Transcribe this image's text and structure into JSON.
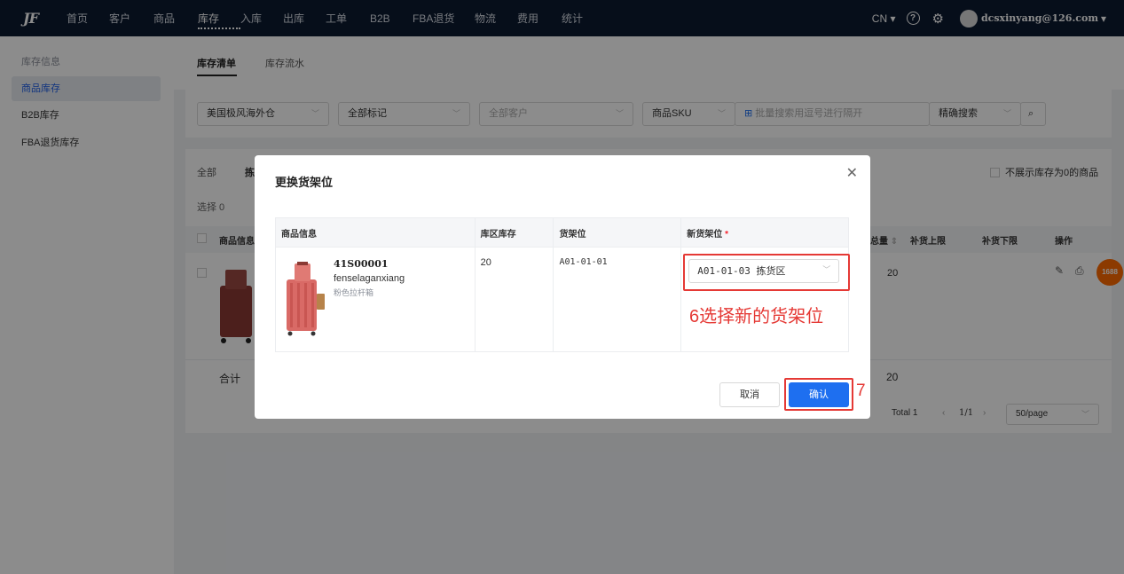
{
  "topbar": {
    "logo": "JF",
    "nav": [
      "首页",
      "客户",
      "商品",
      "库存",
      "入库",
      "出库",
      "工单",
      "B2B",
      "FBA退货",
      "物流",
      "费用",
      "统计"
    ],
    "active_nav": "库存",
    "lang": "CN",
    "user": "dcsxinyang@126.com"
  },
  "sidebar": {
    "items": [
      {
        "label": "库存信息"
      },
      {
        "label": "商品库存"
      },
      {
        "label": "B2B库存"
      },
      {
        "label": "FBA退货库存"
      }
    ]
  },
  "main_tabs": [
    "库存清单",
    "库存流水"
  ],
  "filters": {
    "warehouse": "美国极风海外仓",
    "tags": "全部标记",
    "customer": "全部客户",
    "search_type": "商品SKU",
    "search_placeholder": "批量搜索用逗号进行隔开",
    "mode": "精确搜索"
  },
  "background_list": {
    "sub_tabs": [
      "全部",
      "拣"
    ],
    "selected_count": "选择 0",
    "hide_zero_label": "不展示库存为0的商品",
    "columns": [
      "商品信息",
      "总量",
      "补货上限",
      "补货下限",
      "操作"
    ],
    "row_total": "20",
    "sum_label": "合计",
    "sum_total": "20",
    "pagination": {
      "total": "Total 1",
      "page": "1/1",
      "size": "50/page"
    }
  },
  "dialog": {
    "title": "更换货架位",
    "columns": [
      "商品信息",
      "库区库存",
      "货架位",
      "新货架位"
    ],
    "row": {
      "code": "41S00001",
      "name": "fenselaganxiang",
      "desc": "粉色拉杆箱",
      "stock": "20",
      "shelf": "A01-01-01",
      "new_shelf": "A01-01-03 拣货区"
    },
    "cancel": "取消",
    "confirm": "确认"
  },
  "annotations": {
    "step6": "6选择新的货架位",
    "step7": "7"
  },
  "colors": {
    "primary": "#1e6ff0",
    "annotation": "#e53935",
    "topbar": "#0c1a30"
  }
}
